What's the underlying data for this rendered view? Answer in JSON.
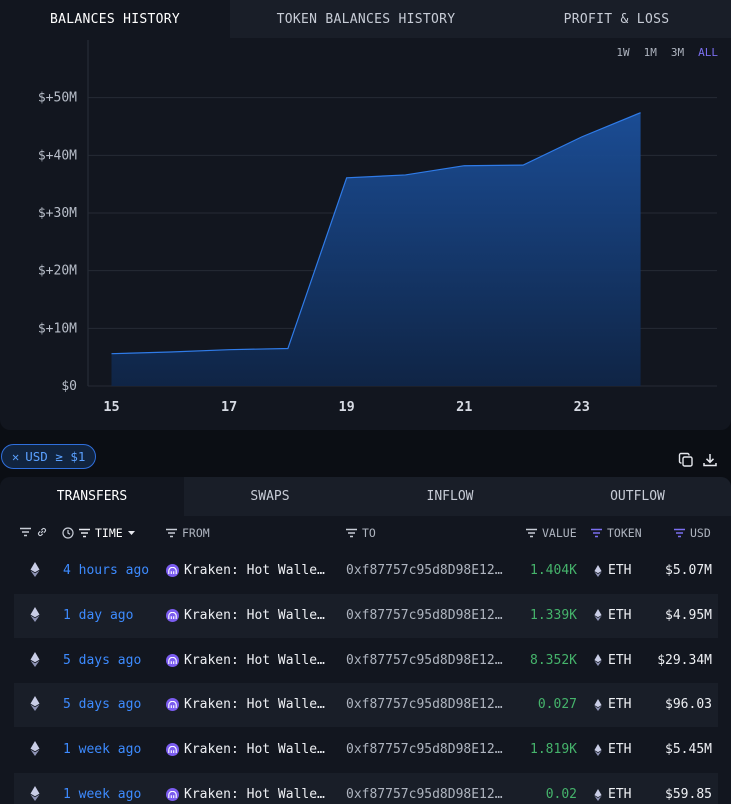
{
  "chart_tabs": [
    {
      "label": "BALANCES HISTORY"
    },
    {
      "label": "TOKEN BALANCES HISTORY"
    },
    {
      "label": "PROFIT & LOSS"
    }
  ],
  "ranges": [
    "1W",
    "1M",
    "3M",
    "ALL"
  ],
  "active_range": "ALL",
  "colors": {
    "accent": "#7b6ff0",
    "link": "#3d8bff",
    "positive": "#45b36b",
    "area": "#1b4f9a"
  },
  "chart_data": {
    "type": "area",
    "x": [
      15,
      16,
      17,
      18,
      19,
      20,
      21,
      22,
      23,
      24
    ],
    "values": [
      5.6,
      5.9,
      6.3,
      6.5,
      36.1,
      36.6,
      38.2,
      38.3,
      43.2,
      47.4
    ],
    "xticks": [
      15,
      17,
      19,
      21,
      23
    ],
    "xtick_labels": [
      "15",
      "17",
      "19",
      "21",
      "23"
    ],
    "yticks": [
      0,
      10,
      20,
      30,
      40,
      50
    ],
    "ytick_labels": [
      "$0",
      "$+10M",
      "$+20M",
      "$+30M",
      "$+40M",
      "$+50M"
    ],
    "xlim": [
      14.6,
      25.3
    ],
    "ylim": [
      0,
      60
    ],
    "grid": true,
    "title": "",
    "xlabel": "",
    "ylabel": ""
  },
  "filter_chip": {
    "icon": "close-icon",
    "label": "USD ≥ $1"
  },
  "table_tabs": [
    {
      "label": "TRANSFERS"
    },
    {
      "label": "SWAPS"
    },
    {
      "label": "INFLOW"
    },
    {
      "label": "OUTFLOW"
    }
  ],
  "headers": {
    "time": "TIME",
    "from": "FROM",
    "to": "TO",
    "value": "VALUE",
    "token": "TOKEN",
    "usd": "USD"
  },
  "rows": [
    {
      "time": "4 hours ago",
      "from": "Kraken: Hot Walle…",
      "to": "0xf87757c95d8D98E12…",
      "value": "1.404K",
      "token": "ETH",
      "usd": "$5.07M"
    },
    {
      "time": "1 day ago",
      "from": "Kraken: Hot Walle…",
      "to": "0xf87757c95d8D98E12…",
      "value": "1.339K",
      "token": "ETH",
      "usd": "$4.95M"
    },
    {
      "time": "5 days ago",
      "from": "Kraken: Hot Walle…",
      "to": "0xf87757c95d8D98E12…",
      "value": "8.352K",
      "token": "ETH",
      "usd": "$29.34M"
    },
    {
      "time": "5 days ago",
      "from": "Kraken: Hot Walle…",
      "to": "0xf87757c95d8D98E12…",
      "value": "0.027",
      "token": "ETH",
      "usd": "$96.03"
    },
    {
      "time": "1 week ago",
      "from": "Kraken: Hot Walle…",
      "to": "0xf87757c95d8D98E12…",
      "value": "1.819K",
      "token": "ETH",
      "usd": "$5.45M"
    },
    {
      "time": "1 week ago",
      "from": "Kraken: Hot Walle…",
      "to": "0xf87757c95d8D98E12…",
      "value": "0.02",
      "token": "ETH",
      "usd": "$59.85"
    }
  ]
}
